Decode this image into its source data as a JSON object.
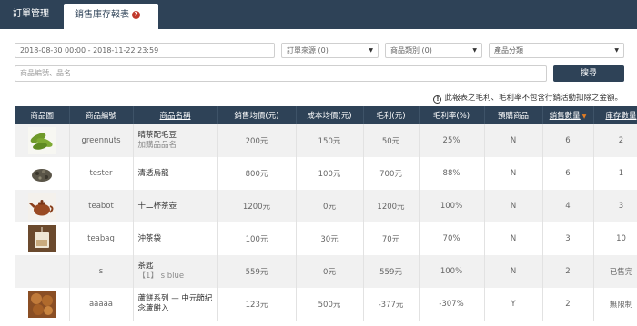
{
  "nav": {
    "tab_orders": "訂單管理",
    "tab_report": "銷售庫存報表"
  },
  "filters": {
    "date_range": "2018-08-30 00:00 - 2018-11-22 23:59",
    "order_source": "訂單來源 (0)",
    "product_category": "商品類別 (0)",
    "product_group": "產品分類",
    "search_placeholder": "商品編號、品名",
    "search_button": "搜尋"
  },
  "notice": "此報表之毛利、毛利率不包含行銷活動扣除之金額。",
  "table": {
    "headers": [
      "商品圖",
      "商品編號",
      "商品名稱",
      "銷售均價(元)",
      "成本均價(元)",
      "毛利(元)",
      "毛利率(%)",
      "預購商品",
      "銷售數量",
      "庫存數量"
    ],
    "rows": [
      {
        "image": "edamame-photo",
        "code": "greennuts",
        "name": "晴茶配毛豆",
        "name_sub": "加購品品名",
        "price": "200元",
        "cost": "150元",
        "profit": "50元",
        "margin": "25%",
        "preorder": "N",
        "qty": "6",
        "stock": "2"
      },
      {
        "image": "tea-leaves-photo",
        "code": "tester",
        "name": "清透烏龍",
        "name_sub": "",
        "price": "800元",
        "cost": "100元",
        "profit": "700元",
        "margin": "88%",
        "preorder": "N",
        "qty": "6",
        "stock": "1"
      },
      {
        "image": "teapot-photo",
        "code": "teabot",
        "name": "十二杯茶壺",
        "name_sub": "",
        "price": "1200元",
        "cost": "0元",
        "profit": "1200元",
        "margin": "100%",
        "preorder": "N",
        "qty": "4",
        "stock": "3"
      },
      {
        "image": "teabag-photo",
        "code": "teabag",
        "name": "沖茶袋",
        "name_sub": "",
        "price": "100元",
        "cost": "30元",
        "profit": "70元",
        "margin": "70%",
        "preorder": "N",
        "qty": "3",
        "stock": "10"
      },
      {
        "image": "",
        "code": "s",
        "name": "茶匙",
        "name_sub": "【1】 s blue",
        "price": "559元",
        "cost": "0元",
        "profit": "559元",
        "margin": "100%",
        "preorder": "N",
        "qty": "2",
        "stock": "已售完"
      },
      {
        "image": "mooncake-photo",
        "code": "aaaaa",
        "name": "蘆餅系列 — 中元節紀念蘆餅入",
        "name_sub": "",
        "price": "123元",
        "cost": "500元",
        "profit": "-377元",
        "margin": "-307%",
        "preorder": "Y",
        "qty": "2",
        "stock": "無限制"
      }
    ]
  },
  "colors": {
    "nav_bg": "#2e4257",
    "help_icon": "#c0392b",
    "sort_indicator": "#e67e22"
  }
}
